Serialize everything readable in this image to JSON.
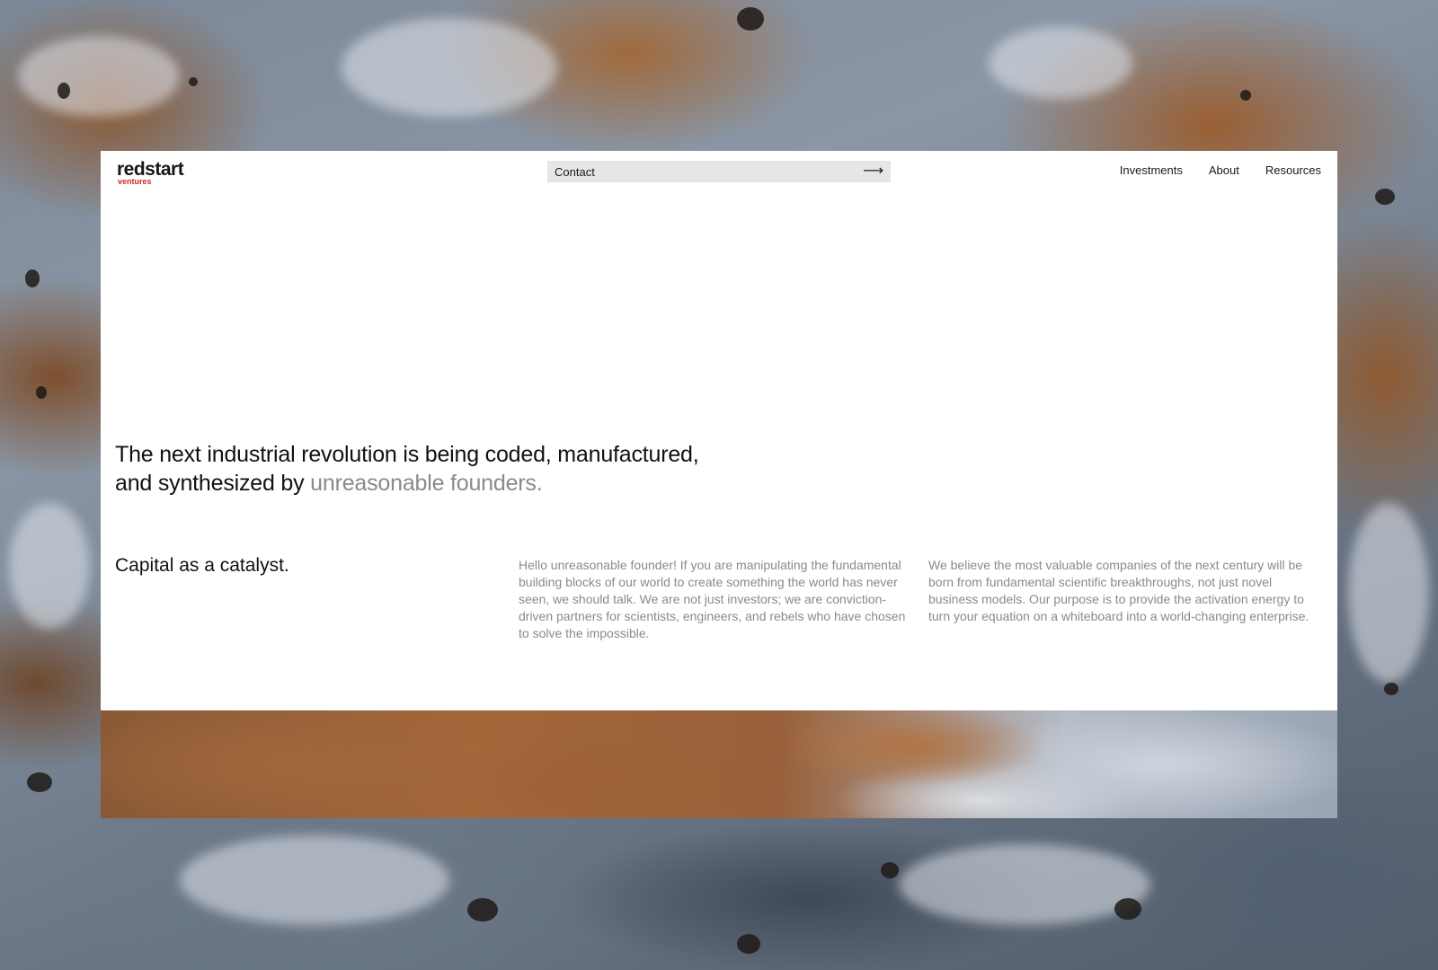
{
  "brand": {
    "name": "redstart",
    "tagline": "ventures",
    "accent_color": "#d2262b"
  },
  "header": {
    "contact_label": "Contact",
    "contact_icon": "arrow-right-icon",
    "nav": [
      {
        "label": "Investments"
      },
      {
        "label": "About"
      },
      {
        "label": "Resources"
      }
    ]
  },
  "hero": {
    "headline_line1": "The next industrial revolution is being coded, manufactured,",
    "headline_line2_prefix": "and synthesized by ",
    "headline_highlight": "unreasonable founders."
  },
  "section": {
    "title": "Capital as a catalyst.",
    "paragraph_1": "Hello unreasonable founder! If you are manipulating the fundamental building blocks of our world to create something the world has never seen, we should talk. We are not just investors; we are conviction-driven partners for scientists, engineers, and rebels who have chosen to solve the impossible.",
    "paragraph_2": "We believe the most valuable companies of the next century will be born from fundamental scientific breakthroughs, not just novel business models. Our purpose is to provide the activation energy to turn your equation on a whiteboard into a world-changing enterprise."
  }
}
